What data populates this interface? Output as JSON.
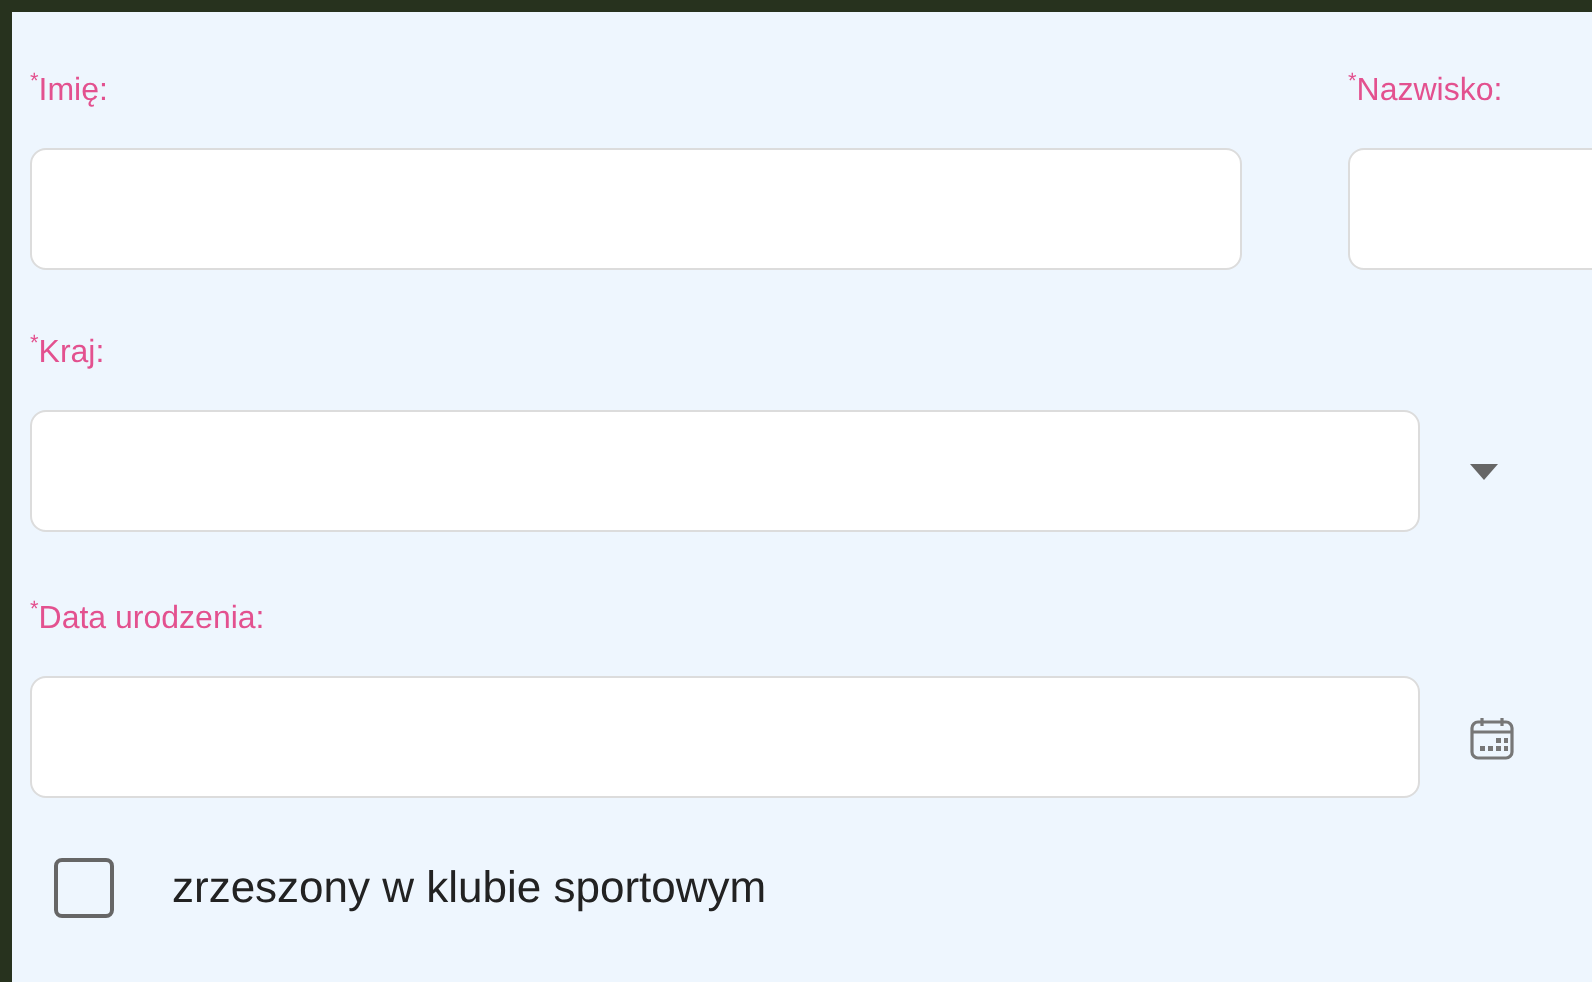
{
  "field_rows": [
    [
      {
        "kind": "text",
        "label": "$^{*}$Imię:"
      },
      {
        "kind": "text",
        "label": "$^{*}$Nazwisko:"
      }
    ],
    [
      {
        "kind": "select",
        "label": "$^{*}$Kraj:"
      }
    ],
    [
      {
        "kind": "date",
        "label": "$^{*}$Data urodzenia:"
      }
    ]
  ],
  "checkbox": {
    "label": "zrzeszony w klubie sportowym",
    "checked": false
  }
}
